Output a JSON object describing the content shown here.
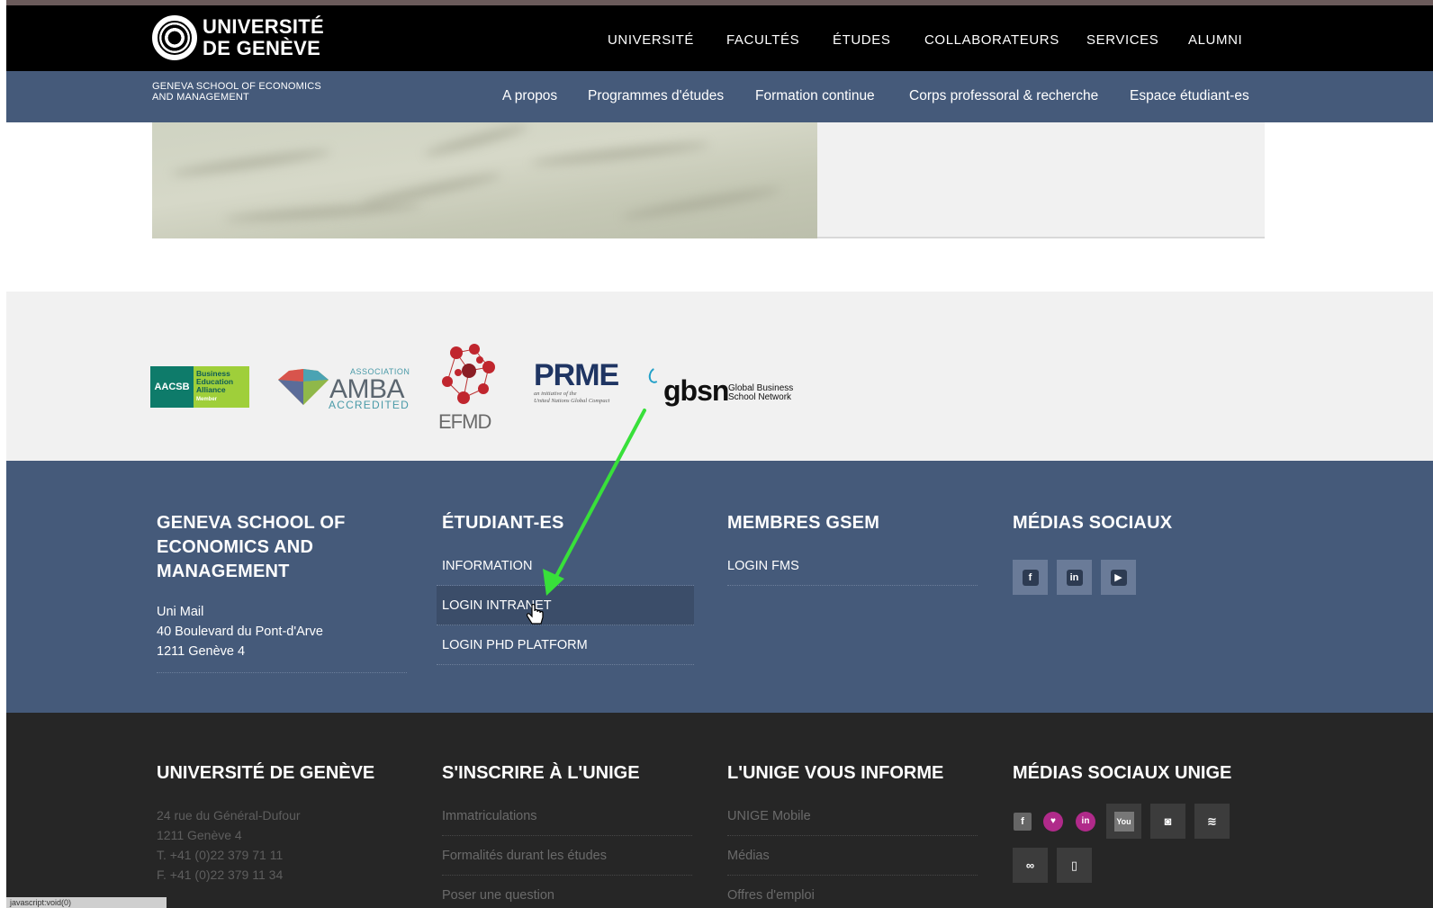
{
  "header": {
    "logo_line1": "UNIVERSITÉ",
    "logo_line2": "DE GENÈVE",
    "main_nav": [
      "UNIVERSITÉ",
      "FACULTÉS",
      "ÉTUDES",
      "COLLABORATEURS",
      "SERVICES",
      "ALUMNI"
    ]
  },
  "subheader": {
    "school_line1": "GENEVA SCHOOL OF ECONOMICS",
    "school_line2": "AND MANAGEMENT",
    "nav": [
      "A propos",
      "Programmes d'études",
      "Formation continue",
      "Corps professoral & recherche",
      "Espace étudiant-es"
    ]
  },
  "accreditations": {
    "aacsb": {
      "left": "AACSB",
      "right": "Business Education Alliance",
      "member": "Member"
    },
    "amba": {
      "top": "ASSOCIATION",
      "main": "AMBA",
      "bottom": "ACCREDITED"
    },
    "efmd": "EFMD",
    "prme": {
      "main": "PRME",
      "sub1": "an initiative of the",
      "sub2": "United Nations Global Compact"
    },
    "gbsn": {
      "main": "gbsn",
      "sub1": "Global Business",
      "sub2": "School Network"
    }
  },
  "footer_blue": {
    "col1": {
      "title": "GENEVA SCHOOL OF ECONOMICS AND MANAGEMENT",
      "addr1": "Uni Mail",
      "addr2": "40 Boulevard du Pont-d'Arve",
      "addr3": "1211 Genève 4"
    },
    "col2": {
      "title": "ÉTUDIANT-ES",
      "links": [
        "INFORMATION",
        "LOGIN INTRANET",
        "LOGIN PHD PLATFORM"
      ]
    },
    "col3": {
      "title": "MEMBRES GSEM",
      "links": [
        "LOGIN FMS"
      ]
    },
    "col4": {
      "title": "MÉDIAS SOCIAUX",
      "icons": [
        "facebook-icon",
        "linkedin-icon",
        "youtube-icon"
      ]
    }
  },
  "footer_dark": {
    "col1": {
      "title": "UNIVERSITÉ DE GENÈVE",
      "addr1": "24 rue du Général-Dufour",
      "addr2": "1211 Genève 4",
      "phone": "T. +41 (0)22 379 71 11",
      "fax": "F. +41 (0)22 379 11 34"
    },
    "col2": {
      "title": "S'INSCRIRE À L'UNIGE",
      "links": [
        "Immatriculations",
        "Formalités durant les études",
        "Poser une question"
      ]
    },
    "col3": {
      "title": "L'UNIGE VOUS INFORME",
      "links": [
        "UNIGE Mobile",
        "Médias",
        "Offres d'emploi"
      ]
    },
    "col4": {
      "title": "MÉDIAS SOCIAUX UNIGE"
    }
  },
  "status_bar": "javascript:void(0)"
}
